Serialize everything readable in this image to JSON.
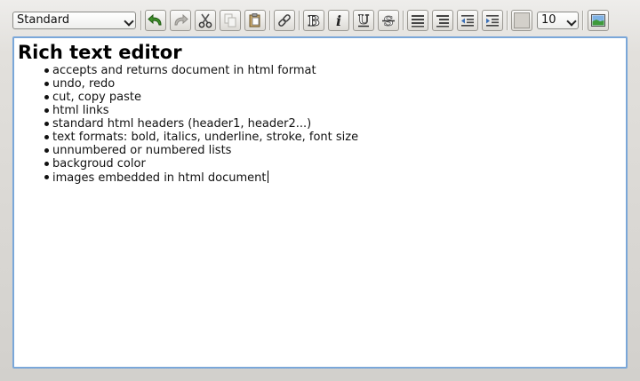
{
  "toolbar": {
    "paragraph_style": "Standard",
    "font_size": "10",
    "color_swatch": "#d3d0ca",
    "buttons": [
      {
        "name": "undo-button",
        "icon": "undo-icon",
        "enabled": true
      },
      {
        "name": "redo-button",
        "icon": "redo-icon",
        "enabled": false
      },
      {
        "name": "cut-button",
        "icon": "scissors-icon",
        "enabled": true
      },
      {
        "name": "copy-button",
        "icon": "copy-icon",
        "enabled": false
      },
      {
        "name": "paste-button",
        "icon": "paste-icon",
        "enabled": true
      },
      {
        "name": "link-button",
        "icon": "link-icon",
        "enabled": true
      },
      {
        "name": "bold-button",
        "icon": "bold-icon",
        "enabled": true
      },
      {
        "name": "italic-button",
        "icon": "italic-icon",
        "enabled": true
      },
      {
        "name": "underline-button",
        "icon": "underline-icon",
        "enabled": true
      },
      {
        "name": "strikethrough-button",
        "icon": "strikethrough-icon",
        "enabled": true
      },
      {
        "name": "unordered-list-button",
        "icon": "bullet-list-icon",
        "enabled": true
      },
      {
        "name": "ordered-list-button",
        "icon": "numbered-list-icon",
        "enabled": true
      },
      {
        "name": "outdent-button",
        "icon": "outdent-icon",
        "enabled": true
      },
      {
        "name": "indent-button",
        "icon": "indent-icon",
        "enabled": true
      },
      {
        "name": "background-color-button",
        "icon": "color-swatch-icon",
        "enabled": true
      },
      {
        "name": "insert-image-button",
        "icon": "image-icon",
        "enabled": true
      }
    ]
  },
  "editor": {
    "heading": "Rich text editor",
    "items": [
      "accepts and returns document in html format",
      "undo, redo",
      "cut, copy paste",
      "html links",
      "standard html headers (header1, header2...)",
      "text formats: bold, italics, underline, stroke, font size",
      "unnumbered or numbered lists",
      "backgroud color",
      "images embedded in html document"
    ],
    "border_color": "#7aa7d9"
  }
}
